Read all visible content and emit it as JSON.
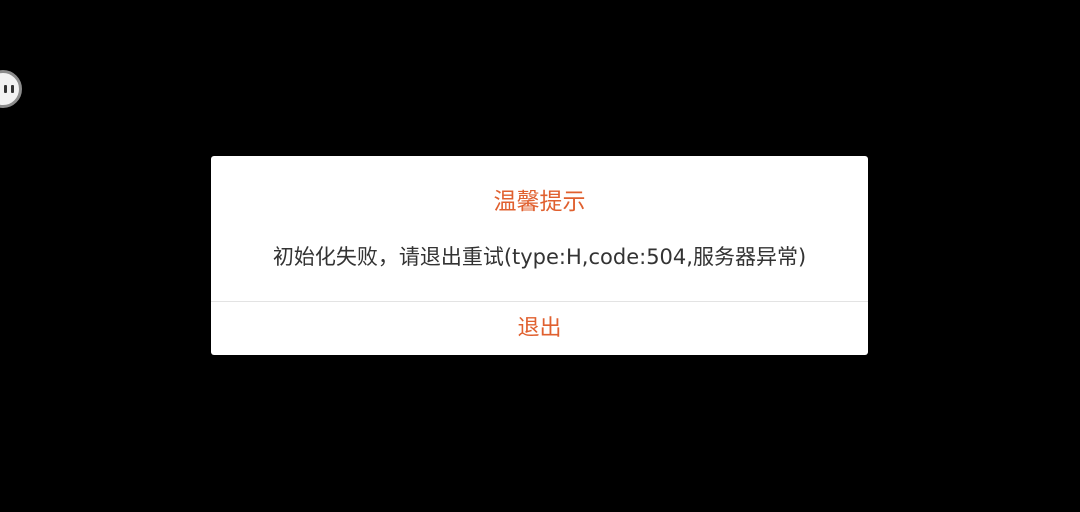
{
  "floating_button": {
    "icon": "assistant-ball-icon"
  },
  "dialog": {
    "title": "温馨提示",
    "message": "初始化失败，请退出重试(type:H,code:504,服务器异常)",
    "button_label": "退出"
  },
  "colors": {
    "background": "#000000",
    "dialog_bg": "#ffffff",
    "accent": "#e0602f",
    "message_text": "#333333",
    "divider": "#e3e3e3"
  }
}
